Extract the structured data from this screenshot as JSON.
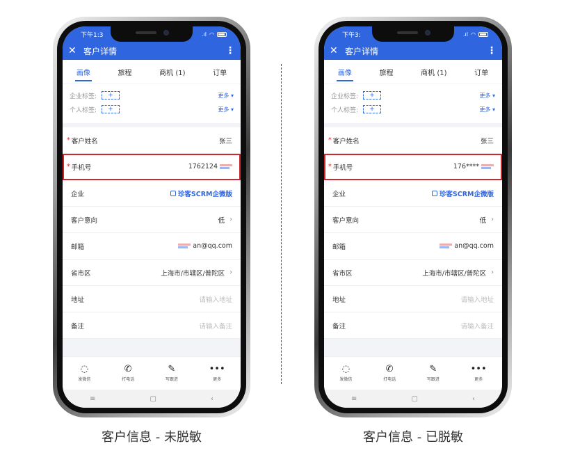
{
  "phones": [
    {
      "status_time": "下午1:3",
      "title": "客户详情",
      "tabs": [
        "画像",
        "旅程",
        "商机 (1)",
        "订单"
      ],
      "tags": [
        {
          "label": "企业标签:",
          "add": "+",
          "more": "更多 ▾"
        },
        {
          "label": "个人标签:",
          "add": "+",
          "more": "更多 ▾"
        }
      ],
      "fields": [
        {
          "label": "客户姓名",
          "value": "张三",
          "required": true
        },
        {
          "label": "手机号",
          "value": "1762124",
          "required": true
        },
        {
          "label": "企业",
          "value": "珍客SCRM企微版"
        },
        {
          "label": "客户意向",
          "value": "低"
        },
        {
          "label": "邮箱",
          "value": "an@qq.com"
        },
        {
          "label": "省市区",
          "value": "上海市/市辖区/普陀区"
        },
        {
          "label": "地址",
          "value": "请输入地址"
        },
        {
          "label": "备注",
          "value": "请输入备注"
        }
      ],
      "actions": [
        {
          "icon": "chat-icon",
          "label": "发微信"
        },
        {
          "icon": "phone-icon",
          "label": "打电话"
        },
        {
          "icon": "edit-icon",
          "label": "写跟进"
        },
        {
          "icon": "more-icon",
          "label": "更多"
        }
      ],
      "caption": "客户信息 - 未脱敏"
    },
    {
      "status_time": "下午3:",
      "title": "客户详情",
      "tabs": [
        "画像",
        "旅程",
        "商机 (1)",
        "订单"
      ],
      "tags": [
        {
          "label": "企业标签:",
          "add": "+",
          "more": "更多 ▾"
        },
        {
          "label": "个人标签:",
          "add": "+",
          "more": "更多 ▾"
        }
      ],
      "fields": [
        {
          "label": "客户姓名",
          "value": "张三",
          "required": true
        },
        {
          "label": "手机号",
          "value": "176****",
          "required": true
        },
        {
          "label": "企业",
          "value": "珍客SCRM企微版"
        },
        {
          "label": "客户意向",
          "value": "低"
        },
        {
          "label": "邮箱",
          "value": "an@qq.com"
        },
        {
          "label": "省市区",
          "value": "上海市/市辖区/普陀区"
        },
        {
          "label": "地址",
          "value": "请输入地址"
        },
        {
          "label": "备注",
          "value": "请输入备注"
        }
      ],
      "actions": [
        {
          "icon": "chat-icon",
          "label": "发微信"
        },
        {
          "icon": "phone-icon",
          "label": "打电话"
        },
        {
          "icon": "edit-icon",
          "label": "写跟进"
        },
        {
          "icon": "more-icon",
          "label": "更多"
        }
      ],
      "caption": "客户信息 - 已脱敏"
    }
  ],
  "colors": {
    "accent": "#2f66e0",
    "highlight": "#d0252a",
    "required": "#e02424"
  }
}
